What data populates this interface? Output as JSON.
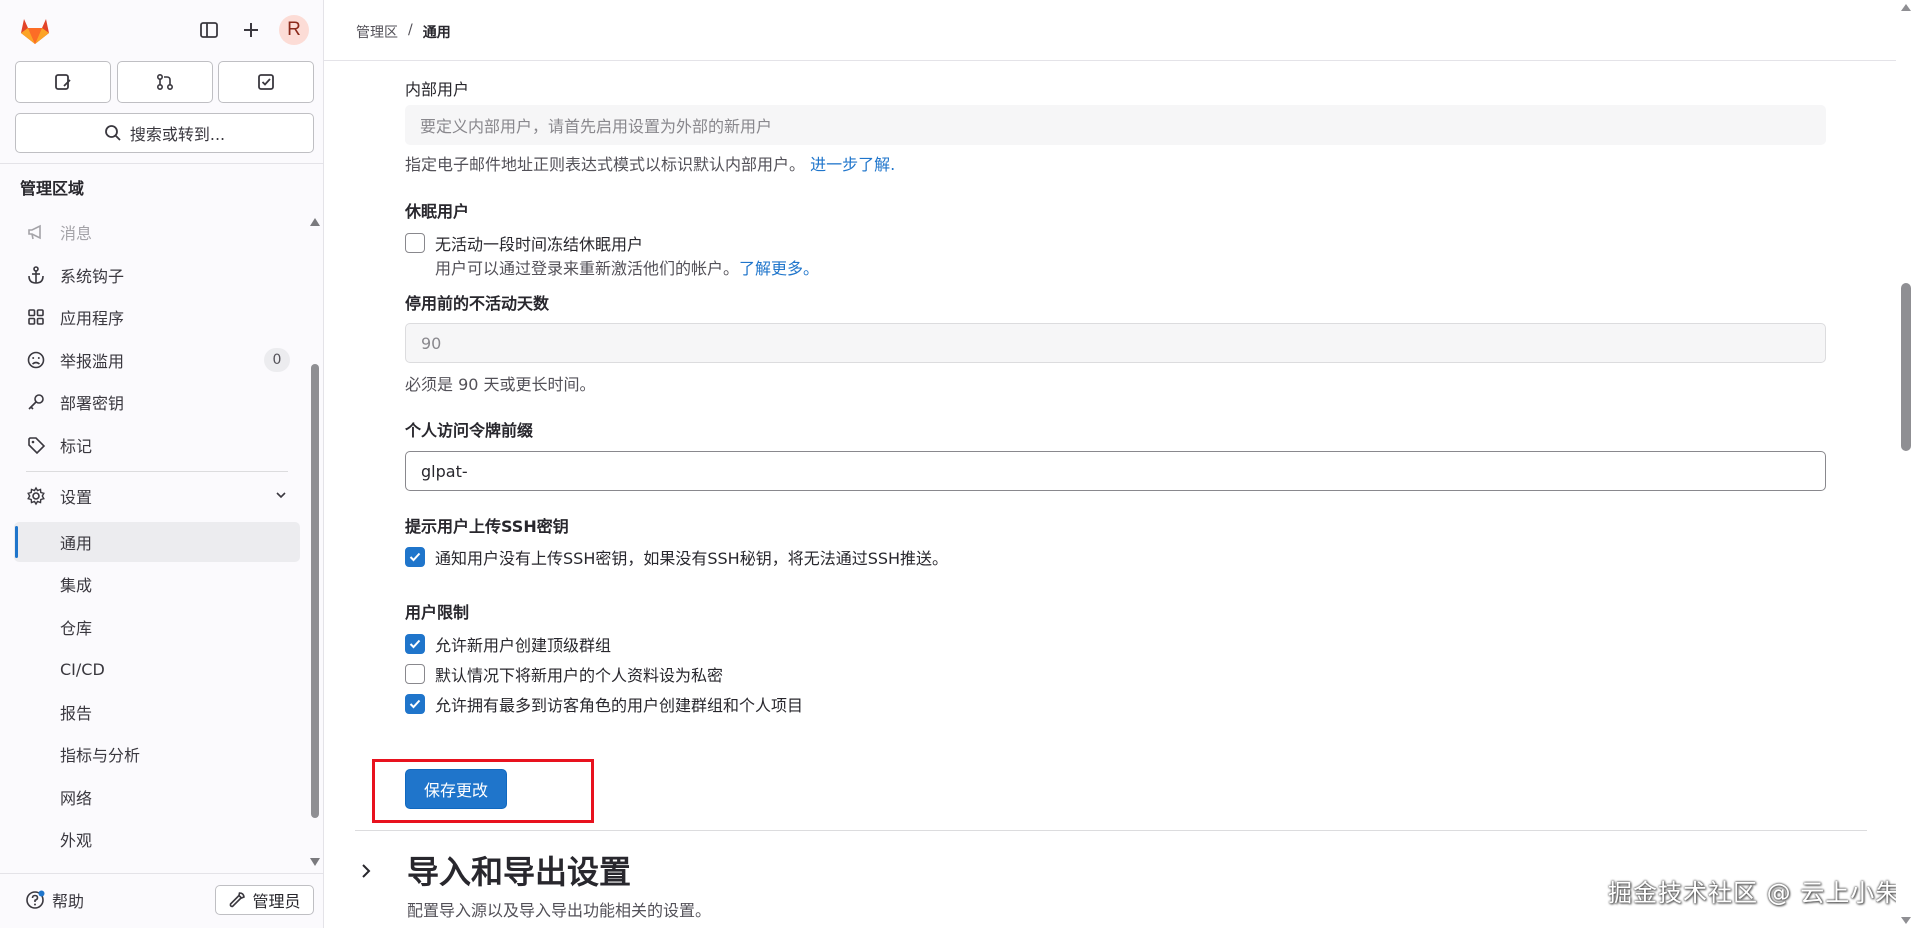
{
  "header": {
    "avatar_initial": "R",
    "breadcrumb": {
      "root": "管理区",
      "separator": "/",
      "current": "通用"
    }
  },
  "sidebar": {
    "search_label": "搜索或转到...",
    "area_title": "管理区域",
    "items": [
      {
        "label": "消息",
        "icon": "megaphone-icon",
        "faded": true
      },
      {
        "label": "系统钩子",
        "icon": "anchor-icon"
      },
      {
        "label": "应用程序",
        "icon": "apps-grid-icon"
      },
      {
        "label": "举报滥用",
        "icon": "sad-face-icon",
        "badge": "0"
      },
      {
        "label": "部署密钥",
        "icon": "key-icon"
      },
      {
        "label": "标记",
        "icon": "label-tag-icon"
      },
      {
        "label": "设置",
        "icon": "gear-icon",
        "expanded": true
      }
    ],
    "settings_subitems": [
      "通用",
      "集成",
      "仓库",
      "CI/CD",
      "报告",
      "指标与分析",
      "网络",
      "外观"
    ],
    "active_subitem": "通用",
    "help_label": "帮助",
    "admin_label": "管理员"
  },
  "form": {
    "internal_users": {
      "label": "内部用户",
      "placeholder": "要定义内部用户，请首先启用设置为外部的新用户",
      "help": "指定电子邮件地址正则表达式模式以标识默认内部用户。",
      "help_link": "进一步了解."
    },
    "dormant_users": {
      "label": "休眠用户",
      "checkbox_label": "无活动一段时间冻结休眠用户",
      "checked": false,
      "sub_text": "用户可以通过登录来重新激活他们的帐户。",
      "sub_link": "了解更多。"
    },
    "inactive_days": {
      "label": "停用前的不活动天数",
      "value": "90",
      "help": "必须是 90 天或更长时间。"
    },
    "token_prefix": {
      "label": "个人访问令牌前缀",
      "value": "glpat-"
    },
    "ssh_prompt": {
      "label": "提示用户上传SSH密钥",
      "checkbox_label": "通知用户没有上传SSH密钥，如果没有SSH秘钥，将无法通过SSH推送。",
      "checked": true
    },
    "user_restrictions": {
      "label": "用户限制",
      "options": [
        {
          "label": "允许新用户创建顶级群组",
          "checked": true
        },
        {
          "label": "默认情况下将新用户的个人资料设为私密",
          "checked": false
        },
        {
          "label": "允许拥有最多到访客角色的用户创建群组和个人项目",
          "checked": true
        }
      ]
    },
    "save_label": "保存更改"
  },
  "next_section": {
    "title": "导入和导出设置",
    "description": "配置导入源以及导入导出功能相关的设置。"
  },
  "watermark": "掘金技术社区 @ 云上小朱",
  "colors": {
    "accent": "#1f75cb",
    "highlight": "#e8121e"
  }
}
